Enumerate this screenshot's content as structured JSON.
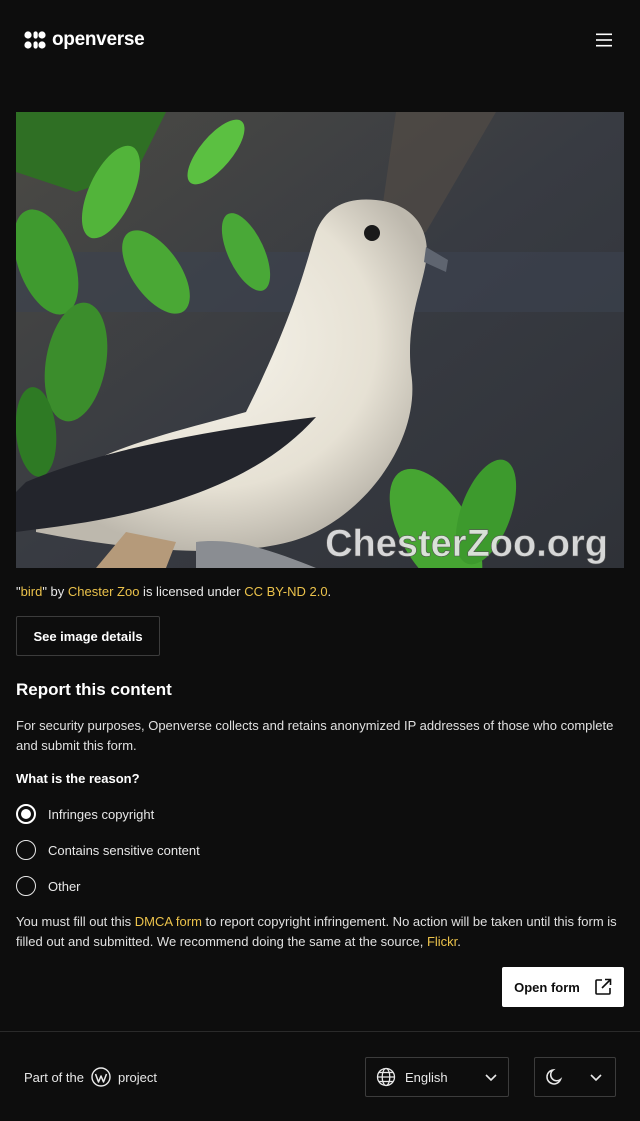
{
  "header": {
    "brand": "openverse",
    "menu_icon": "hamburger-menu-icon"
  },
  "image": {
    "watermark": "ChesterZoo.org",
    "alt_subject": "bird"
  },
  "attribution": {
    "quote_open": "\"",
    "title": "bird",
    "by_text": "\" by ",
    "creator": "Chester Zoo",
    "licensed_text": " is licensed under ",
    "license": "CC BY-ND 2.0",
    "end": "."
  },
  "details_button": "See image details",
  "report": {
    "title": "Report this content",
    "description": "For security purposes, Openverse collects and retains anonymized IP addresses of those who complete and submit this form.",
    "reason_label": "What is the reason?",
    "options": [
      {
        "label": "Infringes copyright",
        "checked": true
      },
      {
        "label": "Contains sensitive content",
        "checked": false
      },
      {
        "label": "Other",
        "checked": false
      }
    ],
    "dmca_pre": "You must fill out this ",
    "dmca_link": "DMCA form",
    "dmca_mid": " to report copyright infringement. No action will be taken until this form is filled out and submitted. We recommend doing the same at the source, ",
    "source_link": "Flickr",
    "dmca_end": ".",
    "open_button": "Open form"
  },
  "footer": {
    "part_of": "Part of the",
    "project": "project",
    "language": "English"
  },
  "colors": {
    "background": "#0d0d0d",
    "link": "#ebc24b",
    "text": "#e8e8e8"
  }
}
